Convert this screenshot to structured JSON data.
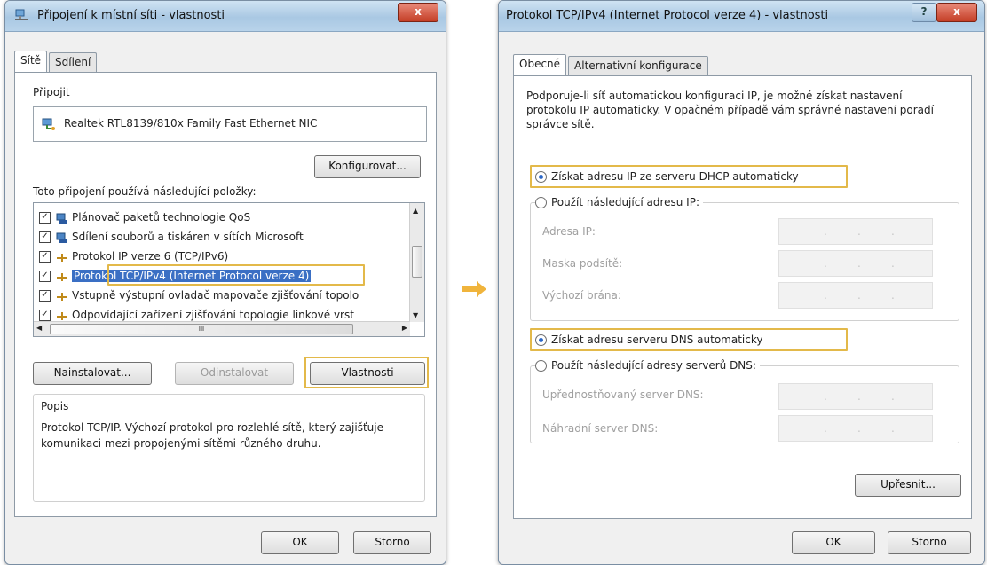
{
  "left_dialog": {
    "title": "Připojení k místní síti - vlastnosti",
    "close_glyph": "x",
    "tabs": [
      "Sítě",
      "Sdílení"
    ],
    "connect_label": "Připojit",
    "adapter_name": "Realtek RTL8139/810x Family Fast Ethernet NIC",
    "configure_button": "Konfigurovat...",
    "items_label": "Toto připojení používá následující položky:",
    "items": [
      {
        "label": "Plánovač paketů technologie QoS",
        "checked": true,
        "icon": "network-service-icon"
      },
      {
        "label": "Sdílení souborů a tiskáren v sítích Microsoft",
        "checked": true,
        "icon": "network-service-icon"
      },
      {
        "label": "Protokol IP verze 6 (TCP/IPv6)",
        "checked": true,
        "icon": "protocol-icon"
      },
      {
        "label": "Protokol TCP/IPv4 (Internet Protocol verze 4)",
        "checked": true,
        "icon": "protocol-icon"
      },
      {
        "label": "Vstupně výstupní ovladač mapovače zjišťování topolo",
        "checked": true,
        "icon": "protocol-icon"
      },
      {
        "label": "Odpovídající zařízení zjišťování topologie linkové vrst",
        "checked": true,
        "icon": "protocol-icon"
      }
    ],
    "hscroll_thumb_label": "III",
    "install_button": "Nainstalovat...",
    "uninstall_button": "Odinstalovat",
    "properties_button": "Vlastnosti",
    "description_label": "Popis",
    "description_text": "Protokol TCP/IP. Výchozí protokol pro rozlehlé sítě, který zajišťuje komunikaci mezi propojenými sítěmi různého druhu.",
    "ok_button": "OK",
    "cancel_button": "Storno"
  },
  "right_dialog": {
    "title": "Protokol TCP/IPv4 (Internet Protocol verze 4) - vlastnosti",
    "help_glyph": "?",
    "close_glyph": "x",
    "tabs": [
      "Obecné",
      "Alternativní konfigurace"
    ],
    "intro_text": "Podporuje-li síť automatickou konfiguraci IP, je možné získat nastavení protokolu IP automaticky. V opačném případě vám správné nastavení poradí správce sítě.",
    "ip_auto_radio": "Získat adresu IP ze serveru DHCP automaticky",
    "ip_manual_radio": "Použít následující adresu IP:",
    "ip_address_label": "Adresa IP:",
    "subnet_mask_label": "Maska podsítě:",
    "gateway_label": "Výchozí brána:",
    "dns_auto_radio": "Získat adresu serveru DNS automaticky",
    "dns_manual_radio": "Použít následující adresy serverů DNS:",
    "preferred_dns_label": "Upřednostňovaný server DNS:",
    "alternate_dns_label": "Náhradní server DNS:",
    "ip_field_dots": ".",
    "advanced_button": "Upřesnit...",
    "ok_button": "OK",
    "cancel_button": "Storno",
    "ip_auto_selected": true,
    "dns_auto_selected": true
  },
  "colors": {
    "highlight": "#e3b94a",
    "selection": "#3a6fc4",
    "arrow": "#f0b43c"
  }
}
